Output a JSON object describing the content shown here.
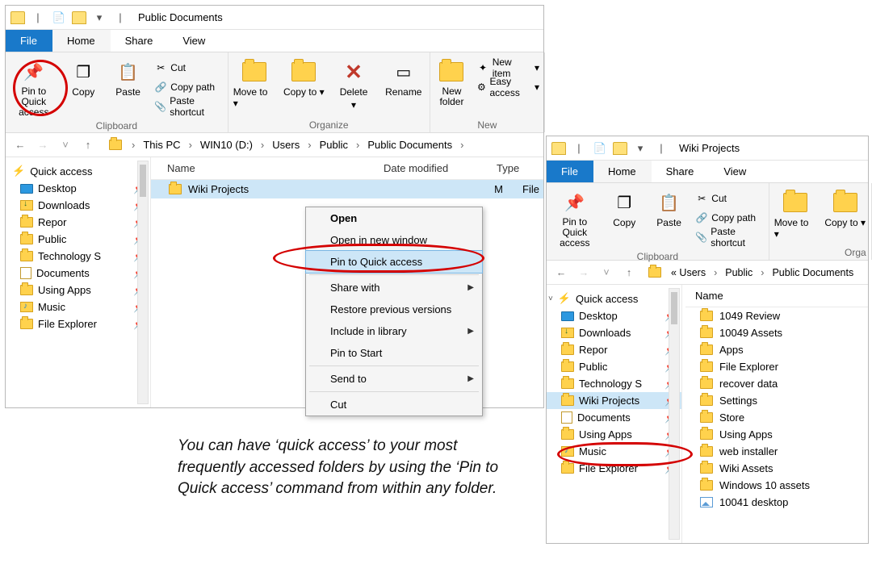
{
  "caption": "You can have ‘quick access’ to your most frequently accessed folders by using the ‘Pin to Quick access’ command from within any folder.",
  "left_window": {
    "title": "Public Documents",
    "tabs": {
      "file": "File",
      "home": "Home",
      "share": "Share",
      "view": "View"
    },
    "ribbon": {
      "pin": "Pin to Quick access",
      "copy": "Copy",
      "paste": "Paste",
      "cut": "Cut",
      "copy_path": "Copy path",
      "paste_shortcut": "Paste shortcut",
      "clipboard_group": "Clipboard",
      "move_to": "Move to",
      "copy_to": "Copy to",
      "delete": "Delete",
      "rename": "Rename",
      "organize_group": "Organize",
      "new_folder": "New folder",
      "new_item": "New item",
      "easy_access": "Easy access",
      "new_group": "New"
    },
    "breadcrumb": [
      "This PC",
      "WIN10 (D:)",
      "Users",
      "Public",
      "Public Documents"
    ],
    "cols": {
      "name": "Name",
      "date": "Date modified",
      "type": "Type"
    },
    "row": {
      "name": "Wiki Projects",
      "date_tail": "M",
      "type_tail": "File"
    },
    "nav": {
      "quick_access": "Quick access",
      "items": [
        {
          "label": "Desktop",
          "icon": "desk"
        },
        {
          "label": "Downloads",
          "icon": "dl"
        },
        {
          "label": "Repor",
          "icon": "folder"
        },
        {
          "label": "Public",
          "icon": "folder"
        },
        {
          "label": "Technology S",
          "icon": "folder"
        },
        {
          "label": "Documents",
          "icon": "doc"
        },
        {
          "label": "Using Apps",
          "icon": "folder"
        },
        {
          "label": "Music",
          "icon": "music"
        },
        {
          "label": "File Explorer",
          "icon": "folder"
        }
      ]
    },
    "ctx": {
      "open": "Open",
      "open_new": "Open in new window",
      "pin_qa": "Pin to Quick access",
      "share": "Share with",
      "restore": "Restore previous versions",
      "include": "Include in library",
      "pin_start": "Pin to Start",
      "send_to": "Send to",
      "cut": "Cut"
    }
  },
  "right_window": {
    "title": "Wiki Projects",
    "tabs": {
      "file": "File",
      "home": "Home",
      "share": "Share",
      "view": "View"
    },
    "ribbon": {
      "pin": "Pin to Quick access",
      "copy": "Copy",
      "paste": "Paste",
      "cut": "Cut",
      "copy_path": "Copy path",
      "paste_shortcut": "Paste shortcut",
      "clipboard_group": "Clipboard",
      "move_to": "Move to",
      "copy_to": "Copy to",
      "organize_group": "Orga"
    },
    "breadcrumb_prefix": "«  Users",
    "breadcrumb_rest": [
      "Public",
      "Public Documents"
    ],
    "nav": {
      "quick_access": "Quick access",
      "items": [
        {
          "label": "Desktop",
          "icon": "desk"
        },
        {
          "label": "Downloads",
          "icon": "dl"
        },
        {
          "label": "Repor",
          "icon": "folder"
        },
        {
          "label": "Public",
          "icon": "folder"
        },
        {
          "label": "Technology S",
          "icon": "folder"
        },
        {
          "label": "Wiki Projects",
          "icon": "folder",
          "sel": true
        },
        {
          "label": "Documents",
          "icon": "doc"
        },
        {
          "label": "Using Apps",
          "icon": "folder"
        },
        {
          "label": "Music",
          "icon": "music"
        },
        {
          "label": "File Explorer",
          "icon": "folder"
        }
      ]
    },
    "col_name": "Name",
    "folders": [
      "1049 Review",
      "10049 Assets",
      "Apps",
      "File Explorer",
      "recover data",
      "Settings",
      "Store",
      "Using Apps",
      "web installer",
      "Wiki Assets",
      "Windows 10 assets"
    ],
    "last_file": "10041 desktop"
  }
}
